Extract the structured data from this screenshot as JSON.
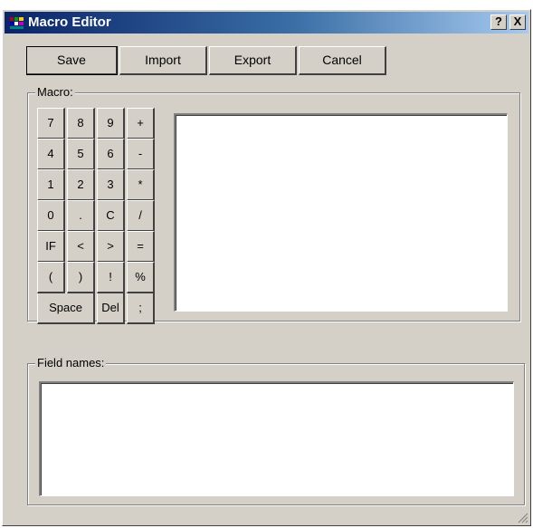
{
  "window": {
    "title": "Macro Editor",
    "help_label": "?",
    "close_label": "X"
  },
  "toolbar": {
    "save_label": "Save",
    "import_label": "Import",
    "export_label": "Export",
    "cancel_label": "Cancel"
  },
  "macro": {
    "label": "Macro:",
    "keys": [
      [
        "7",
        "8",
        "9",
        "+"
      ],
      [
        "4",
        "5",
        "6",
        "-"
      ],
      [
        "1",
        "2",
        "3",
        "*"
      ],
      [
        "0",
        ".",
        "C",
        "/"
      ],
      [
        "IF",
        "<",
        ">",
        "="
      ],
      [
        "(",
        ")",
        "!",
        "%"
      ]
    ],
    "space_label": "Space",
    "del_label": "Del",
    "semicolon_label": ";",
    "text_value": ""
  },
  "field_names": {
    "label": "Field names:",
    "text_value": ""
  },
  "colors": {
    "window_bg": "#d4d0c8",
    "titlebar_start": "#0a246a",
    "titlebar_end": "#a6caf0"
  }
}
